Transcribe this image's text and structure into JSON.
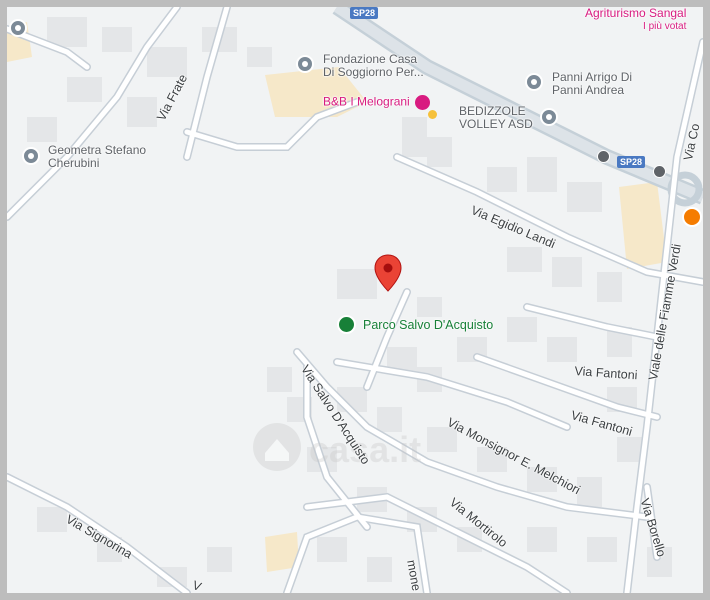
{
  "map": {
    "pois": [
      {
        "id": "fondazione",
        "line1": "Fondazione Casa",
        "line2": "Di Soggiorno Per..."
      },
      {
        "id": "bb",
        "line1": "B&B I Melograni"
      },
      {
        "id": "panni",
        "line1": "Panni Arrigo Di",
        "line2": "Panni Andrea"
      },
      {
        "id": "bedizzole",
        "line1": "BEDIZZOLE",
        "line2": "VOLLEY ASD"
      },
      {
        "id": "geometra",
        "line1": "Geometra Stefano",
        "line2": "Cherubini"
      },
      {
        "id": "agriturismo",
        "line1": "Agriturismo Sangal",
        "line2": "I più votat"
      },
      {
        "id": "parco",
        "line1": "Parco Salvo D'Acquisto"
      }
    ],
    "streets": {
      "via_frate": "Via Frate",
      "via_egidio_landi": "Via Egidio Landi",
      "viale_fiamme_verdi": "Viale delle Fiamme Verdi",
      "via_co": "Via Co",
      "via_fantoni_1": "Via Fantoni",
      "via_fantoni_2": "Via Fantoni",
      "via_salvo": "Via Salvo D'Acquisto",
      "via_monsignor": "Via Monsignor E. Melchiori",
      "via_mortirolo": "Via Mortirolo",
      "via_signorina": "Via Signorina",
      "via_borello": "Via Borello",
      "via_v": "V",
      "via_mone": "mone"
    },
    "shields": {
      "top": "SP28",
      "right": "SP28"
    },
    "watermark": "casa.it",
    "colors": {
      "pin": "#ea4335",
      "park": "#188038",
      "poi": "#7c8a97",
      "pink": "#d81b80",
      "road": "#ffffff",
      "major_road": "#aab8c2"
    }
  }
}
